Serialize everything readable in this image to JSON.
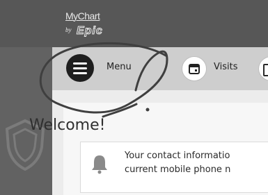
{
  "header": {
    "logo_text": "MyChart",
    "logo_by": "by",
    "logo_vendor": "Epic",
    "background": "#575757"
  },
  "nav": {
    "menu_label": "Menu",
    "visits_label": "Visits"
  },
  "main": {
    "welcome_title": "Welcome!",
    "alert_line1": "Your contact informatio",
    "alert_line2": "current mobile phone n"
  },
  "icons": {
    "menu": "hamburger-menu-icon",
    "visits": "calendar-icon",
    "alert": "bell-icon",
    "sidebar": "shield-icon"
  },
  "colors": {
    "sidebar": "#626262",
    "nav_row": "#cecece",
    "ink": "#2a2a2a"
  }
}
